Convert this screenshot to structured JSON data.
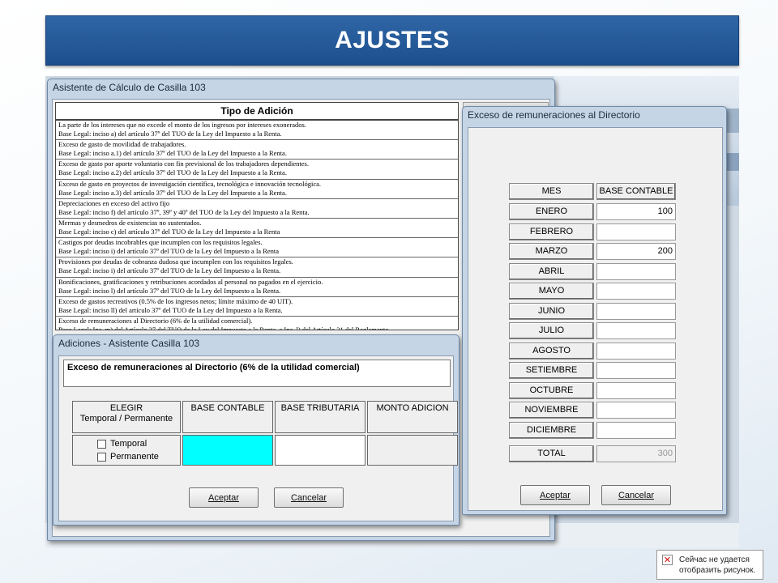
{
  "slide_title": "AJUSTES",
  "asistente": {
    "title": "Asistente de Cálculo de Casilla 103",
    "table_header": "Tipo de Adición",
    "rows": [
      [
        "La parte de los intereses que no excede el monto de los ingresos por intereses exonerados.",
        "Base Legal: inciso a) del artículo 37º del TUO de la Ley del Impuesto a la Renta."
      ],
      [
        "Exceso de gasto de movilidad de trabajadores.",
        "Base Legal: inciso a.1) del artículo 37º del TUO de la Ley del Impuesto a la Renta."
      ],
      [
        "Exceso de gasto por aporte voluntario con fin previsional de los trabajadores dependientes.",
        "Base Legal: inciso a.2) del artículo 37º del TUO de la Ley del Impuesto a la Renta."
      ],
      [
        "Exceso de gasto en proyectos de investigación científica, tecnológica e innovación tecnológica.",
        "Base Legal: inciso a.3) del artículo 37º del TUO de la Ley del Impuesto a la Renta."
      ],
      [
        "Depreciaciones en exceso del activo fijo",
        "Base Legal: inciso f) del artículo 37º, 39º y 40º del TUO de la Ley del Impuesto a la Renta."
      ],
      [
        "Mermas y desmedros de existencias no sustentados.",
        "Base Legal: inciso c) del artículo 37º del TUO de la Ley del Impuesto a la Renta"
      ],
      [
        "Castigos por deudas incobrables que incumplen con los requisitos legales.",
        "Base Legal: inciso i) del artículo 37º del TUO de la Ley del Impuesto a la Renta"
      ],
      [
        "Provisiones por deudas de cobranza dudosa que incumplen con los requisitos legales.",
        "Base Legal: inciso i) del artículo 37º del TUO de la Ley del Impuesto a la Renta."
      ],
      [
        "Bonificaciones, gratificaciones y retribuciones acordados al personal no pagados en el ejercicio.",
        "Base Legal: inciso l) del artículo 37º del TUO de la Ley del Impuesto a la Renta."
      ],
      [
        "Exceso de gastos recreativos (0.5% de los ingresos netos; límite máximo de 40 UIT).",
        "Base Legal: inciso ll) del artículo 37º del TUO de la Ley del Impuesto a la Renta."
      ],
      [
        "Exceso de remuneraciones al Directorio (6% de la utilidad comercial).",
        "Base Legal: Inc. m) del Artículo 37 del TUO de la Ley del Impuesto a la Renta, e Inc. l) del Artículo 21 del Reglamento"
      ]
    ]
  },
  "adiciones": {
    "title": "Adiciones - Asistente Casilla 103",
    "heading": "Exceso de remuneraciones al Directorio (6% de la utilidad comercial)",
    "col_elegir_1": "ELEGIR",
    "col_elegir_2": "Temporal / Permanente",
    "col_base_contable": "BASE CONTABLE",
    "col_base_tributaria": "BASE TRIBUTARIA",
    "col_monto": "MONTO ADICION",
    "opt_temporal": "Temporal",
    "opt_permanente": "Permanente",
    "btn_aceptar": "Aceptar",
    "btn_cancelar": "Cancelar"
  },
  "exceso": {
    "title": "Exceso de remuneraciones al Directorio",
    "col_mes": "MES",
    "col_base": "BASE CONTABLE",
    "months": [
      {
        "mes": "ENERO",
        "valor": "100"
      },
      {
        "mes": "FEBRERO",
        "valor": ""
      },
      {
        "mes": "MARZO",
        "valor": "200"
      },
      {
        "mes": "ABRIL",
        "valor": ""
      },
      {
        "mes": "MAYO",
        "valor": ""
      },
      {
        "mes": "JUNIO",
        "valor": ""
      },
      {
        "mes": "JULIO",
        "valor": ""
      },
      {
        "mes": "AGOSTO",
        "valor": ""
      },
      {
        "mes": "SETIEMBRE",
        "valor": ""
      },
      {
        "mes": "OCTUBRE",
        "valor": ""
      },
      {
        "mes": "NOVIEMBRE",
        "valor": ""
      },
      {
        "mes": "DICIEMBRE",
        "valor": ""
      }
    ],
    "total_label": "TOTAL",
    "total_value": "300",
    "btn_aceptar": "Aceptar",
    "btn_cancelar": "Cancelar"
  },
  "broken_image": {
    "text": "Сейчас не удается отобразить рисунок."
  },
  "colors": {
    "title_bar": "#1d4f8e",
    "highlight_cell": "#00ffff"
  }
}
